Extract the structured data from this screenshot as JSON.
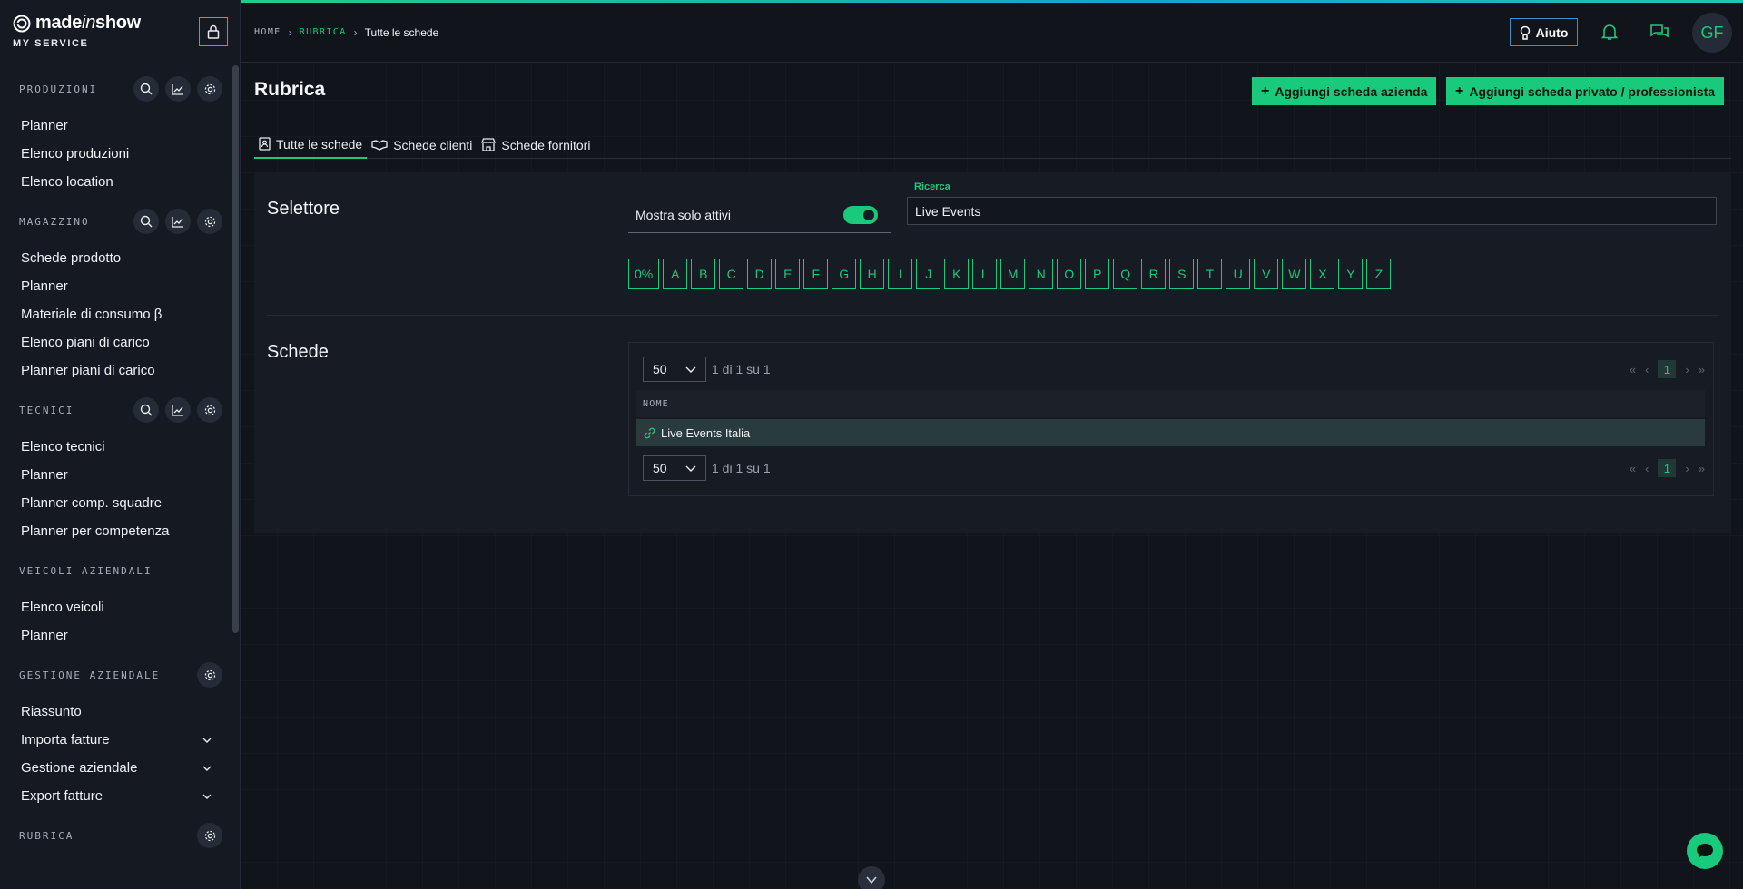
{
  "brand": {
    "name_prefix": "made",
    "name_italic": "in",
    "name_suffix": "show",
    "subtitle": "MY SERVICE"
  },
  "sidebar": {
    "sections": [
      {
        "title": "PRODUZIONI",
        "items": [
          "Planner",
          "Elenco produzioni",
          "Elenco location"
        ]
      },
      {
        "title": "MAGAZZINO",
        "items": [
          "Schede prodotto",
          "Planner",
          "Materiale di consumo β",
          "Elenco piani di carico",
          "Planner piani di carico"
        ]
      },
      {
        "title": "TECNICI",
        "items": [
          "Elenco tecnici",
          "Planner",
          "Planner comp. squadre",
          "Planner per competenza"
        ]
      },
      {
        "title": "VEICOLI AZIENDALI",
        "items": [
          "Elenco veicoli",
          "Planner"
        ]
      },
      {
        "title": "GESTIONE AZIENDALE",
        "items": [
          "Riassunto",
          "Importa fatture",
          "Gestione aziendale",
          "Export fatture"
        ]
      },
      {
        "title": "RUBRICA",
        "items": []
      }
    ]
  },
  "breadcrumb": {
    "home": "HOME",
    "section": "RUBRICA",
    "current": "Tutte le schede"
  },
  "header": {
    "help_label": "Aiuto",
    "avatar_initials": "GF"
  },
  "page": {
    "title": "Rubrica",
    "add_company_label": "Aggiungi scheda azienda",
    "add_private_label": "Aggiungi scheda privato / professionista"
  },
  "tabs": [
    "Tutte le schede",
    "Schede clienti",
    "Schede fornitori"
  ],
  "selector": {
    "title": "Selettore",
    "toggle_label": "Mostra solo attivi",
    "toggle_on": true,
    "search_label": "Ricerca",
    "search_value": "Live Events",
    "letters": [
      "0%",
      "A",
      "B",
      "C",
      "D",
      "E",
      "F",
      "G",
      "H",
      "I",
      "J",
      "K",
      "L",
      "M",
      "N",
      "O",
      "P",
      "Q",
      "R",
      "S",
      "T",
      "U",
      "V",
      "W",
      "X",
      "Y",
      "Z"
    ]
  },
  "records": {
    "title": "Schede",
    "per_page": "50",
    "range_text": "1 di 1 su 1",
    "current_page": "1",
    "column_header": "NOME",
    "rows": [
      "Live Events Italia"
    ]
  },
  "colors": {
    "accent": "#19c97c",
    "background": "#11141b",
    "sidebar": "#151922",
    "help_border": "#3a8fc6"
  }
}
